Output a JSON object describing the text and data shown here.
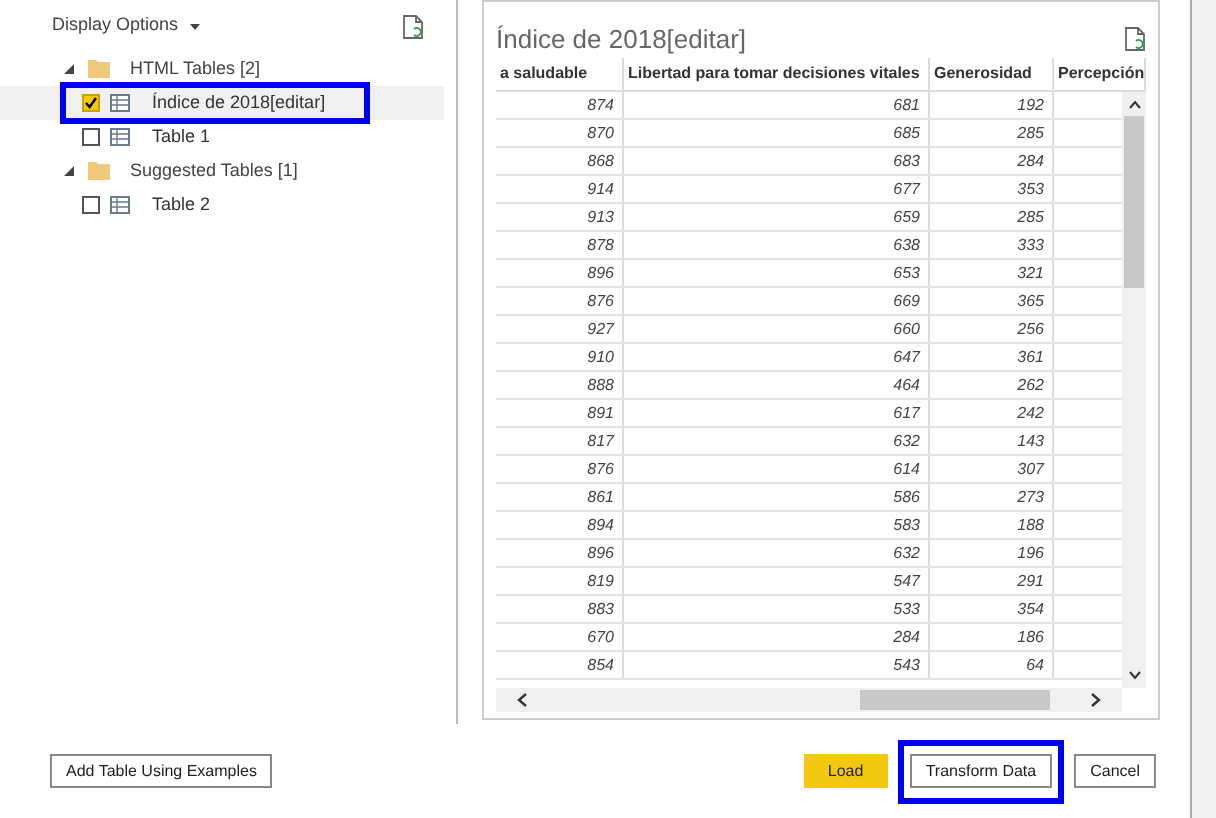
{
  "navigator": {
    "display_options": "Display Options",
    "tree": [
      {
        "label": "HTML Tables [2]",
        "expanded": true,
        "children": [
          {
            "label": "Índice de 2018[editar]",
            "checked": true,
            "selected": true,
            "highlighted": true
          },
          {
            "label": "Table 1",
            "checked": false,
            "selected": false,
            "highlighted": false
          }
        ]
      },
      {
        "label": "Suggested Tables [1]",
        "expanded": true,
        "children": [
          {
            "label": "Table 2",
            "checked": false,
            "selected": false,
            "highlighted": false
          }
        ]
      }
    ]
  },
  "preview": {
    "title": "Índice de 2018[editar]",
    "table": {
      "columns": [
        "a saludable",
        "Libertad para tomar decisiones vitales",
        "Generosidad",
        "Percepción"
      ],
      "rows": [
        [
          "874",
          "681",
          "192"
        ],
        [
          "870",
          "685",
          "285"
        ],
        [
          "868",
          "683",
          "284"
        ],
        [
          "914",
          "677",
          "353"
        ],
        [
          "913",
          "659",
          "285"
        ],
        [
          "878",
          "638",
          "333"
        ],
        [
          "896",
          "653",
          "321"
        ],
        [
          "876",
          "669",
          "365"
        ],
        [
          "927",
          "660",
          "256"
        ],
        [
          "910",
          "647",
          "361"
        ],
        [
          "888",
          "464",
          "262"
        ],
        [
          "891",
          "617",
          "242"
        ],
        [
          "817",
          "632",
          "143"
        ],
        [
          "876",
          "614",
          "307"
        ],
        [
          "861",
          "586",
          "273"
        ],
        [
          "894",
          "583",
          "188"
        ],
        [
          "896",
          "632",
          "196"
        ],
        [
          "819",
          "547",
          "291"
        ],
        [
          "883",
          "533",
          "354"
        ],
        [
          "670",
          "284",
          "186"
        ],
        [
          "854",
          "543",
          "64"
        ]
      ]
    }
  },
  "buttons": [
    {
      "label": "Add Table Using Examples",
      "kind": "default",
      "highlighted": false
    },
    {
      "label": "Load",
      "kind": "primary",
      "highlighted": false
    },
    {
      "label": "Transform Data",
      "kind": "default",
      "highlighted": true
    },
    {
      "label": "Cancel",
      "kind": "default",
      "highlighted": false
    }
  ]
}
